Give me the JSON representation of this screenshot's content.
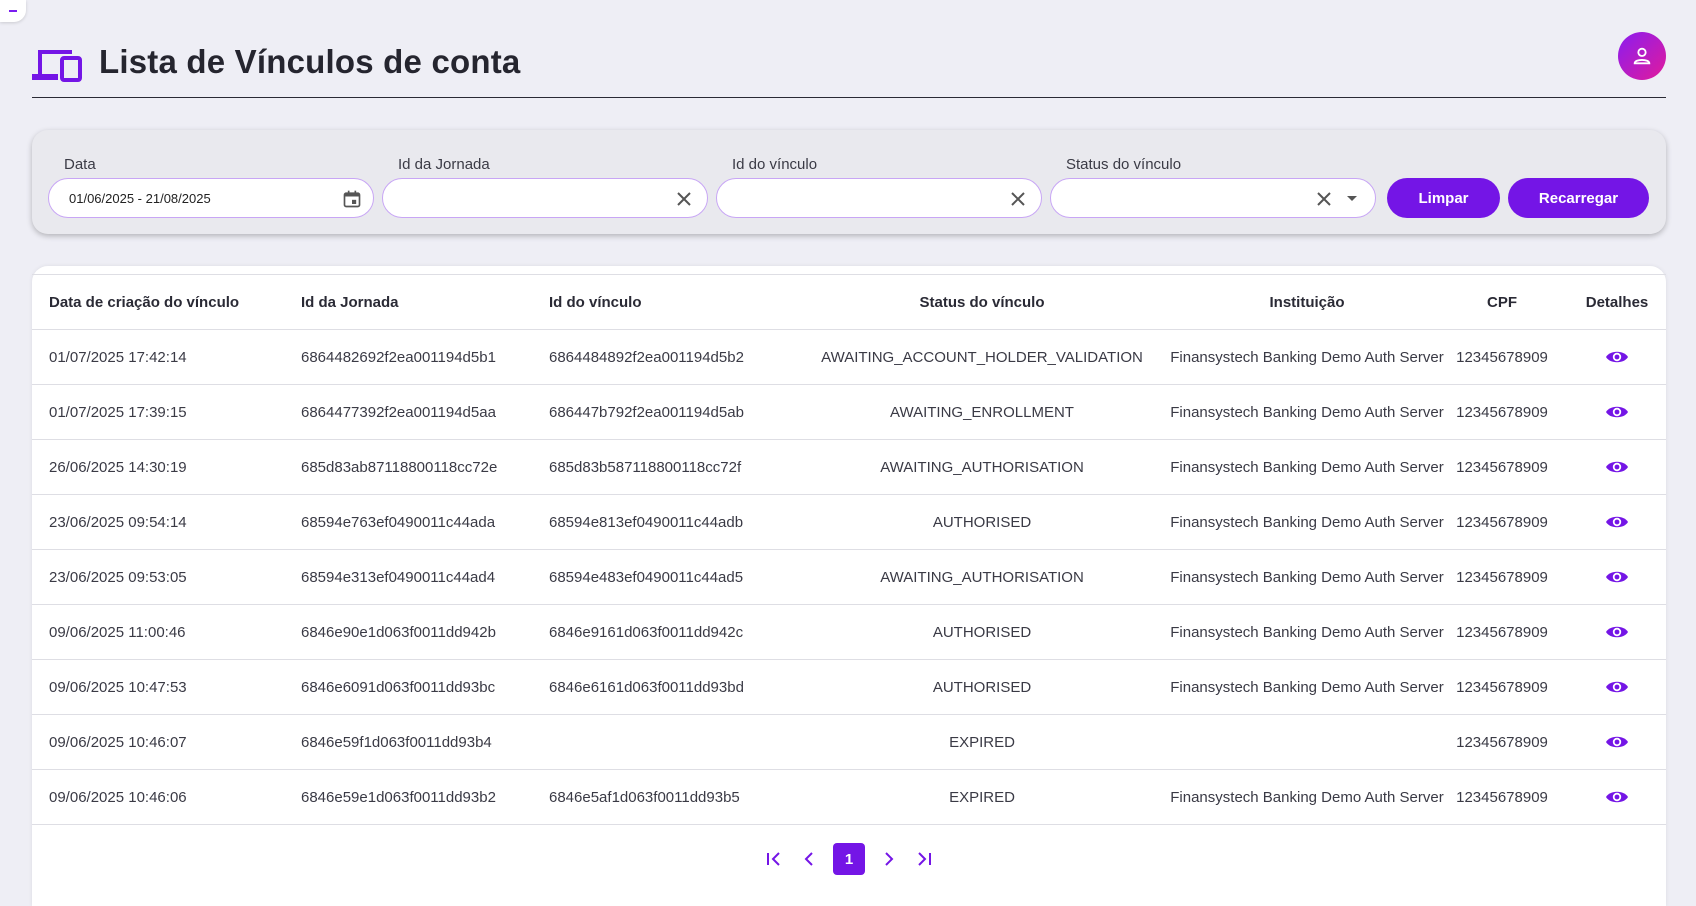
{
  "header": {
    "title": "Lista de Vínculos de conta",
    "icon": "devices-icon",
    "avatar_icon": "person-icon"
  },
  "colors": {
    "accent": "#7415e6",
    "avatar_gradient_start": "#8a1cf0",
    "avatar_gradient_end": "#e21b9b",
    "background": "#eeeef5"
  },
  "filters": {
    "date": {
      "label": "Data",
      "value": "01/06/2025 - 21/08/2025",
      "icon": "calendar-icon"
    },
    "jornada": {
      "label": "Id da Jornada",
      "value": "",
      "icon": "clear-icon"
    },
    "vinculo": {
      "label": "Id do vínculo",
      "value": "",
      "icon": "clear-icon"
    },
    "status": {
      "label": "Status do vínculo",
      "value": "",
      "icon": "clear-icon",
      "dropdown_icon": "caret-down-icon"
    },
    "clear_button": "Limpar",
    "reload_button": "Recarregar"
  },
  "table": {
    "columns": [
      "Data de criação do vínculo",
      "Id da Jornada",
      "Id do vínculo",
      "Status do vínculo",
      "Instituição",
      "CPF",
      "Detalhes"
    ],
    "rows": [
      {
        "date": "01/07/2025 17:42:14",
        "jornada": "6864482692f2ea001194d5b1",
        "vinculo": "6864484892f2ea001194d5b2",
        "status": "AWAITING_ACCOUNT_HOLDER_VALIDATION",
        "inst": "Finansystech Banking Demo Auth Server",
        "cpf": "12345678909"
      },
      {
        "date": "01/07/2025 17:39:15",
        "jornada": "6864477392f2ea001194d5aa",
        "vinculo": "686447b792f2ea001194d5ab",
        "status": "AWAITING_ENROLLMENT",
        "inst": "Finansystech Banking Demo Auth Server",
        "cpf": "12345678909"
      },
      {
        "date": "26/06/2025 14:30:19",
        "jornada": "685d83ab87118800118cc72e",
        "vinculo": "685d83b587118800118cc72f",
        "status": "AWAITING_AUTHORISATION",
        "inst": "Finansystech Banking Demo Auth Server",
        "cpf": "12345678909"
      },
      {
        "date": "23/06/2025 09:54:14",
        "jornada": "68594e763ef0490011c44ada",
        "vinculo": "68594e813ef0490011c44adb",
        "status": "AUTHORISED",
        "inst": "Finansystech Banking Demo Auth Server",
        "cpf": "12345678909"
      },
      {
        "date": "23/06/2025 09:53:05",
        "jornada": "68594e313ef0490011c44ad4",
        "vinculo": "68594e483ef0490011c44ad5",
        "status": "AWAITING_AUTHORISATION",
        "inst": "Finansystech Banking Demo Auth Server",
        "cpf": "12345678909"
      },
      {
        "date": "09/06/2025 11:00:46",
        "jornada": "6846e90e1d063f0011dd942b",
        "vinculo": "6846e9161d063f0011dd942c",
        "status": "AUTHORISED",
        "inst": "Finansystech Banking Demo Auth Server",
        "cpf": "12345678909"
      },
      {
        "date": "09/06/2025 10:47:53",
        "jornada": "6846e6091d063f0011dd93bc",
        "vinculo": "6846e6161d063f0011dd93bd",
        "status": "AUTHORISED",
        "inst": "Finansystech Banking Demo Auth Server",
        "cpf": "12345678909"
      },
      {
        "date": "09/06/2025 10:46:07",
        "jornada": "6846e59f1d063f0011dd93b4",
        "vinculo": "",
        "status": "EXPIRED",
        "inst": "",
        "cpf": "12345678909"
      },
      {
        "date": "09/06/2025 10:46:06",
        "jornada": "6846e59e1d063f0011dd93b2",
        "vinculo": "6846e5af1d063f0011dd93b5",
        "status": "EXPIRED",
        "inst": "Finansystech Banking Demo Auth Server",
        "cpf": "12345678909"
      }
    ],
    "details_icon": "eye-icon"
  },
  "pagination": {
    "current_page": "1",
    "icons": [
      "first-page-icon",
      "prev-page-icon",
      "next-page-icon",
      "last-page-icon"
    ]
  }
}
